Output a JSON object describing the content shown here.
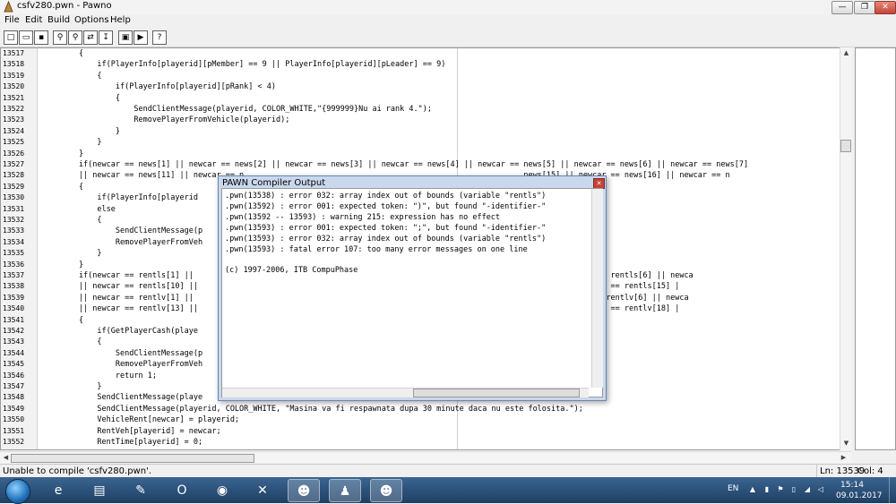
{
  "window": {
    "title": "csfv280.pwn - Pawno",
    "minimize_glyph": "—",
    "maximize_glyph": "❐",
    "close_glyph": "✕"
  },
  "menu": [
    "File",
    "Edit",
    "Build",
    "Options",
    "Help"
  ],
  "toolbar": {
    "buttons": [
      {
        "name": "new-file-icon",
        "glyph": "□"
      },
      {
        "name": "open-folder-icon",
        "glyph": "▭"
      },
      {
        "name": "save-icon",
        "glyph": "▪"
      },
      {
        "name": "find-icon",
        "glyph": "⚲"
      },
      {
        "name": "find-next-icon",
        "glyph": "⚲"
      },
      {
        "name": "replace-icon",
        "glyph": "⇄"
      },
      {
        "name": "goto-line-icon",
        "glyph": "↧"
      },
      {
        "name": "compile-icon",
        "glyph": "▣"
      },
      {
        "name": "run-icon",
        "glyph": "▶"
      },
      {
        "name": "help-icon",
        "glyph": "?"
      }
    ]
  },
  "editor": {
    "lines": [
      {
        "num": "13517",
        "text": "        {"
      },
      {
        "num": "13518",
        "text": "            if(PlayerInfo[playerid][pMember] == 9 || PlayerInfo[playerid][pLeader] == 9)"
      },
      {
        "num": "13519",
        "text": "            {"
      },
      {
        "num": "13520",
        "text": "                if(PlayerInfo[playerid][pRank] < 4)"
      },
      {
        "num": "13521",
        "text": "                {"
      },
      {
        "num": "13522",
        "text": "                    SendClientMessage(playerid, COLOR_WHITE,\"{999999}Nu ai rank 4.\");"
      },
      {
        "num": "13523",
        "text": "                    RemovePlayerFromVehicle(playerid);"
      },
      {
        "num": "13524",
        "text": "                }"
      },
      {
        "num": "13525",
        "text": "            }"
      },
      {
        "num": "13526",
        "text": "        }"
      },
      {
        "num": "13527",
        "text": "        if(newcar == news[1] || newcar == news[2] || newcar == news[3] || newcar == news[4] || newcar == news[5] || newcar == news[6] || newcar == news[7]"
      },
      {
        "num": "13528",
        "text": "        || newcar == news[11] || newcar == n                                                             news[15] || newcar == news[16] || newcar == n"
      },
      {
        "num": "13529",
        "text": "        {"
      },
      {
        "num": "13530",
        "text": "            if(PlayerInfo[playerid"
      },
      {
        "num": "13531",
        "text": "            else"
      },
      {
        "num": "13532",
        "text": "            {"
      },
      {
        "num": "13533",
        "text": "                SendClientMessage(p"
      },
      {
        "num": "13534",
        "text": "                RemovePlayerFromVeh"
      },
      {
        "num": "13535",
        "text": "            }"
      },
      {
        "num": "13536",
        "text": "        }"
      },
      {
        "num": "13537",
        "text": "        if(newcar == rentls[1] ||                                                                 == rentls[5] || newcar == rentls[6] || newca"
      },
      {
        "num": "13538",
        "text": "        || newcar == rentls[10] ||                                                              car == rentls[14] || newcar == rentls[15] |"
      },
      {
        "num": "13539",
        "text": "        || newcar == rentlv[1] ||                                                                == rentlv[5] || newcar == rentlv[6] || newca"
      },
      {
        "num": "13540",
        "text": "        || newcar == rentlv[13] ||                                                              car == rentlv[17] || newcar == rentlv[18] |"
      },
      {
        "num": "13541",
        "text": "        {"
      },
      {
        "num": "13542",
        "text": "            if(GetPlayerCash(playe"
      },
      {
        "num": "13543",
        "text": "            {"
      },
      {
        "num": "13544",
        "text": "                SendClientMessage(p"
      },
      {
        "num": "13545",
        "text": "                RemovePlayerFromVeh"
      },
      {
        "num": "13546",
        "text": "                return 1;"
      },
      {
        "num": "13547",
        "text": "            }"
      },
      {
        "num": "13548",
        "text": "            SendClientMessage(playe                                                                   olosesti masina.\");"
      },
      {
        "num": "13549",
        "text": "            SendClientMessage(playerid, COLOR_WHITE, \"Masina va fi respawnata dupa 30 minute daca nu este folosita.\");"
      },
      {
        "num": "13550",
        "text": "            VehicleRent[newcar] = playerid;"
      },
      {
        "num": "13551",
        "text": "            RentVeh[playerid] = newcar;"
      },
      {
        "num": "13552",
        "text": "            RentTime[playerid] = 0;"
      }
    ]
  },
  "status": {
    "message": "Unable to compile 'csfv280.pwn'.",
    "line": "Ln: 13539",
    "col": "Col: 4"
  },
  "dialog": {
    "title": "PAWN Compiler Output",
    "close_glyph": "✕",
    "lines": [
      ".pwn(13538) : error 032: array index out of bounds (variable \"rentls\")",
      ".pwn(13592) : error 001: expected token: \")\", but found \"-identifier-\"",
      ".pwn(13592 -- 13593) : warning 215: expression has no effect",
      ".pwn(13593) : error 001: expected token: \";\", but found \"-identifier-\"",
      ".pwn(13593) : error 032: array index out of bounds (variable \"rentls\")",
      ".pwn(13593) : fatal error 107: too many error messages on one line",
      "",
      "(c) 1997-2006, ITB CompuPhase"
    ]
  },
  "taskbar": {
    "apps": [
      {
        "name": "internet-explorer-icon",
        "glyph": "e"
      },
      {
        "name": "file-explorer-icon",
        "glyph": "▤"
      },
      {
        "name": "paint-icon",
        "glyph": "✎"
      },
      {
        "name": "opera-icon",
        "glyph": "O"
      },
      {
        "name": "firefox-icon",
        "glyph": "◉"
      },
      {
        "name": "xampp-icon",
        "glyph": "✕"
      },
      {
        "name": "samp-icon",
        "glyph": "☻"
      },
      {
        "name": "pawno-icon",
        "glyph": "♟"
      },
      {
        "name": "gta-icon",
        "glyph": "☻"
      }
    ],
    "lang": "EN",
    "time": "15:14",
    "date": "09.01.2017"
  }
}
